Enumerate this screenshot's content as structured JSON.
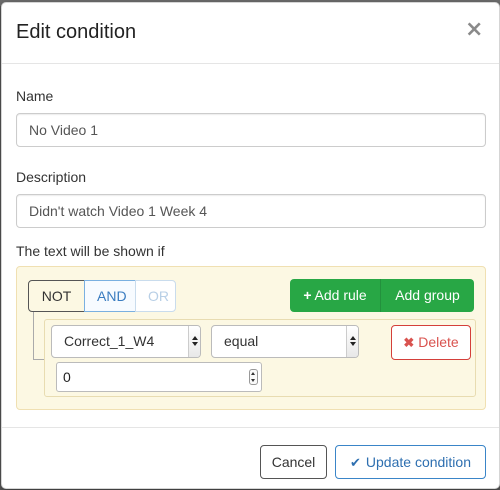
{
  "modal": {
    "title": "Edit condition",
    "close_symbol": "×"
  },
  "form": {
    "name_label": "Name",
    "name_value": "No Video 1",
    "description_label": "Description",
    "description_value": "Didn't watch Video 1 Week 4",
    "shown_if_label": "The text will be shown if"
  },
  "builder": {
    "conditions": [
      "NOT",
      "AND",
      "OR"
    ],
    "add_rule_label": "Add rule",
    "add_group_label": "Add group",
    "rule": {
      "field": "Correct_1_W4",
      "operator": "equal",
      "value": "0",
      "delete_label": "Delete"
    }
  },
  "footer": {
    "cancel_label": "Cancel",
    "update_label": "Update condition"
  },
  "icons": {
    "plus": "+",
    "times": "✖",
    "check": "✔"
  },
  "colors": {
    "builder_bg": "#fcf8e3",
    "add_button": "#28a745",
    "delete": "#d9534f",
    "primary": "#2e6fb0"
  }
}
